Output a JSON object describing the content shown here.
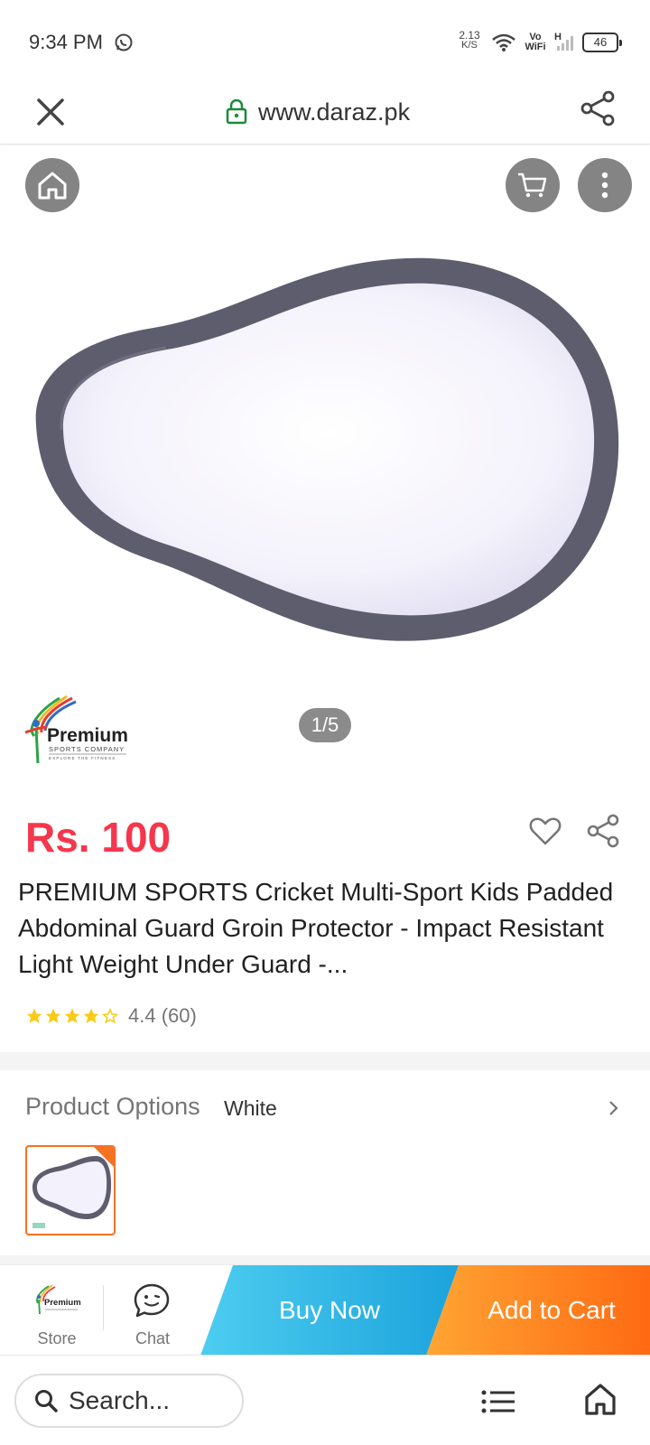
{
  "status": {
    "time": "9:34 PM",
    "speed_value": "2.13",
    "speed_unit": "K/S",
    "vowifi_line1": "Vo",
    "vowifi_line2": "WiFi",
    "signal_label": "H",
    "battery": "46"
  },
  "browser": {
    "url": "www.daraz.pk"
  },
  "gallery": {
    "counter": "1/5"
  },
  "brand": {
    "name": "Premium",
    "subtitle": "SPORTS COMPANY",
    "tagline": "EXPLORE THE FITNESS"
  },
  "product": {
    "price": "Rs. 100",
    "title": "PREMIUM SPORTS Cricket Multi-Sport Kids Padded Abdominal Guard Groin Protector - Impact Resistant Light Weight Under Guard -...",
    "rating_text": "4.4 (60)",
    "rating_value": 4.4
  },
  "options": {
    "label": "Product Options",
    "value": "White"
  },
  "action_bar": {
    "store_label": "Store",
    "chat_label": "Chat",
    "buy_now": "Buy Now",
    "add_to_cart": "Add to Cart"
  },
  "bottom_nav": {
    "search_placeholder": "Search..."
  },
  "colors": {
    "price": "#f5364c",
    "accent_orange": "#f57224",
    "buy_now": "#1ca3dc",
    "add_to_cart": "#ff6a13"
  }
}
